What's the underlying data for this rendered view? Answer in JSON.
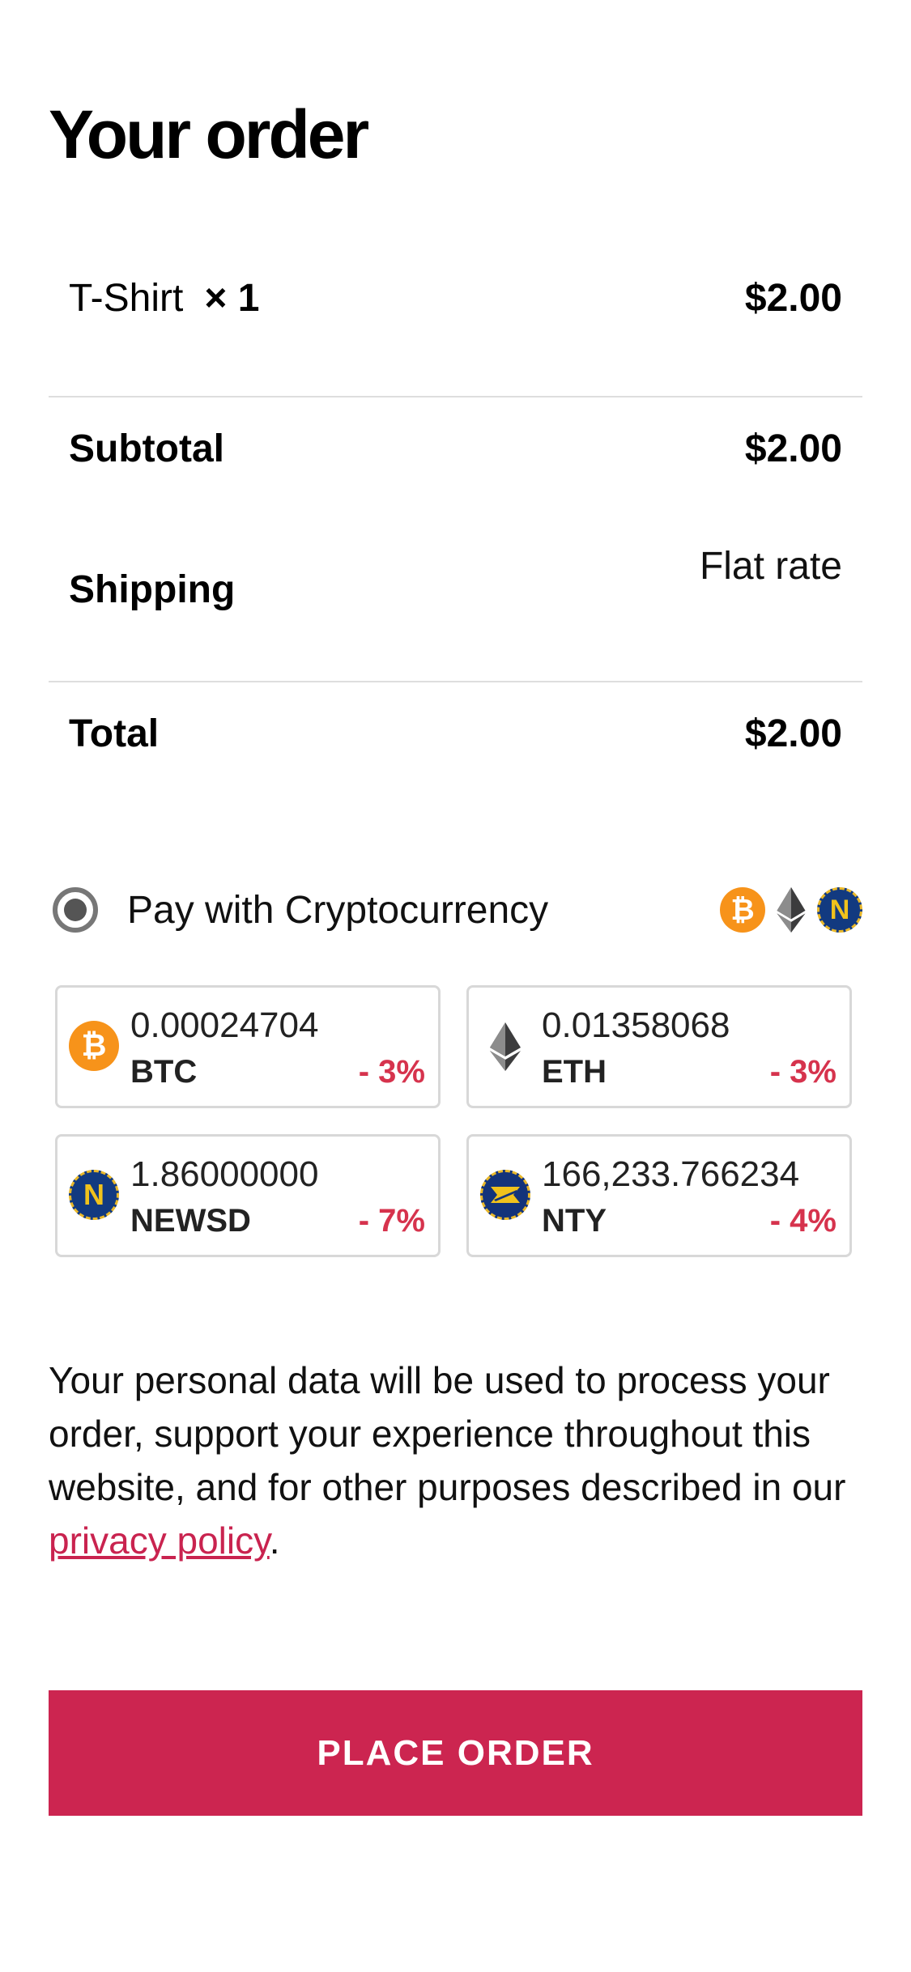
{
  "page_title": "Your order",
  "item": {
    "name": "T-Shirt",
    "qty": "× 1",
    "price": "$2.00"
  },
  "subtotal": {
    "label": "Subtotal",
    "value": "$2.00"
  },
  "shipping": {
    "label": "Shipping",
    "value": "Flat rate"
  },
  "total": {
    "label": "Total",
    "value": "$2.00"
  },
  "payment": {
    "label": "Pay with Cryptocurrency",
    "selected": true,
    "icons": [
      "bitcoin-icon",
      "ethereum-icon",
      "newsd-icon"
    ]
  },
  "coins": [
    {
      "amount": "0.00024704",
      "symbol": "BTC",
      "discount": "- 3%",
      "icon": "bitcoin-icon"
    },
    {
      "amount": "0.01358068",
      "symbol": "ETH",
      "discount": "- 3%",
      "icon": "ethereum-icon"
    },
    {
      "amount": "1.86000000",
      "symbol": "NEWSD",
      "discount": "- 7%",
      "icon": "newsd-icon"
    },
    {
      "amount": "166,233.766234",
      "symbol": "NTY",
      "discount": "- 4%",
      "icon": "nty-icon"
    }
  ],
  "privacy": {
    "text": "Your personal data will be used to process your order, support your experience throughout this website, and for other purposes described in our ",
    "link": "privacy policy",
    "end": "."
  },
  "place_order_label": "PLACE ORDER",
  "colors": {
    "accent": "#cc2550",
    "discount": "#d6334d",
    "btc": "#f7931a",
    "newsd": "#123a80"
  }
}
